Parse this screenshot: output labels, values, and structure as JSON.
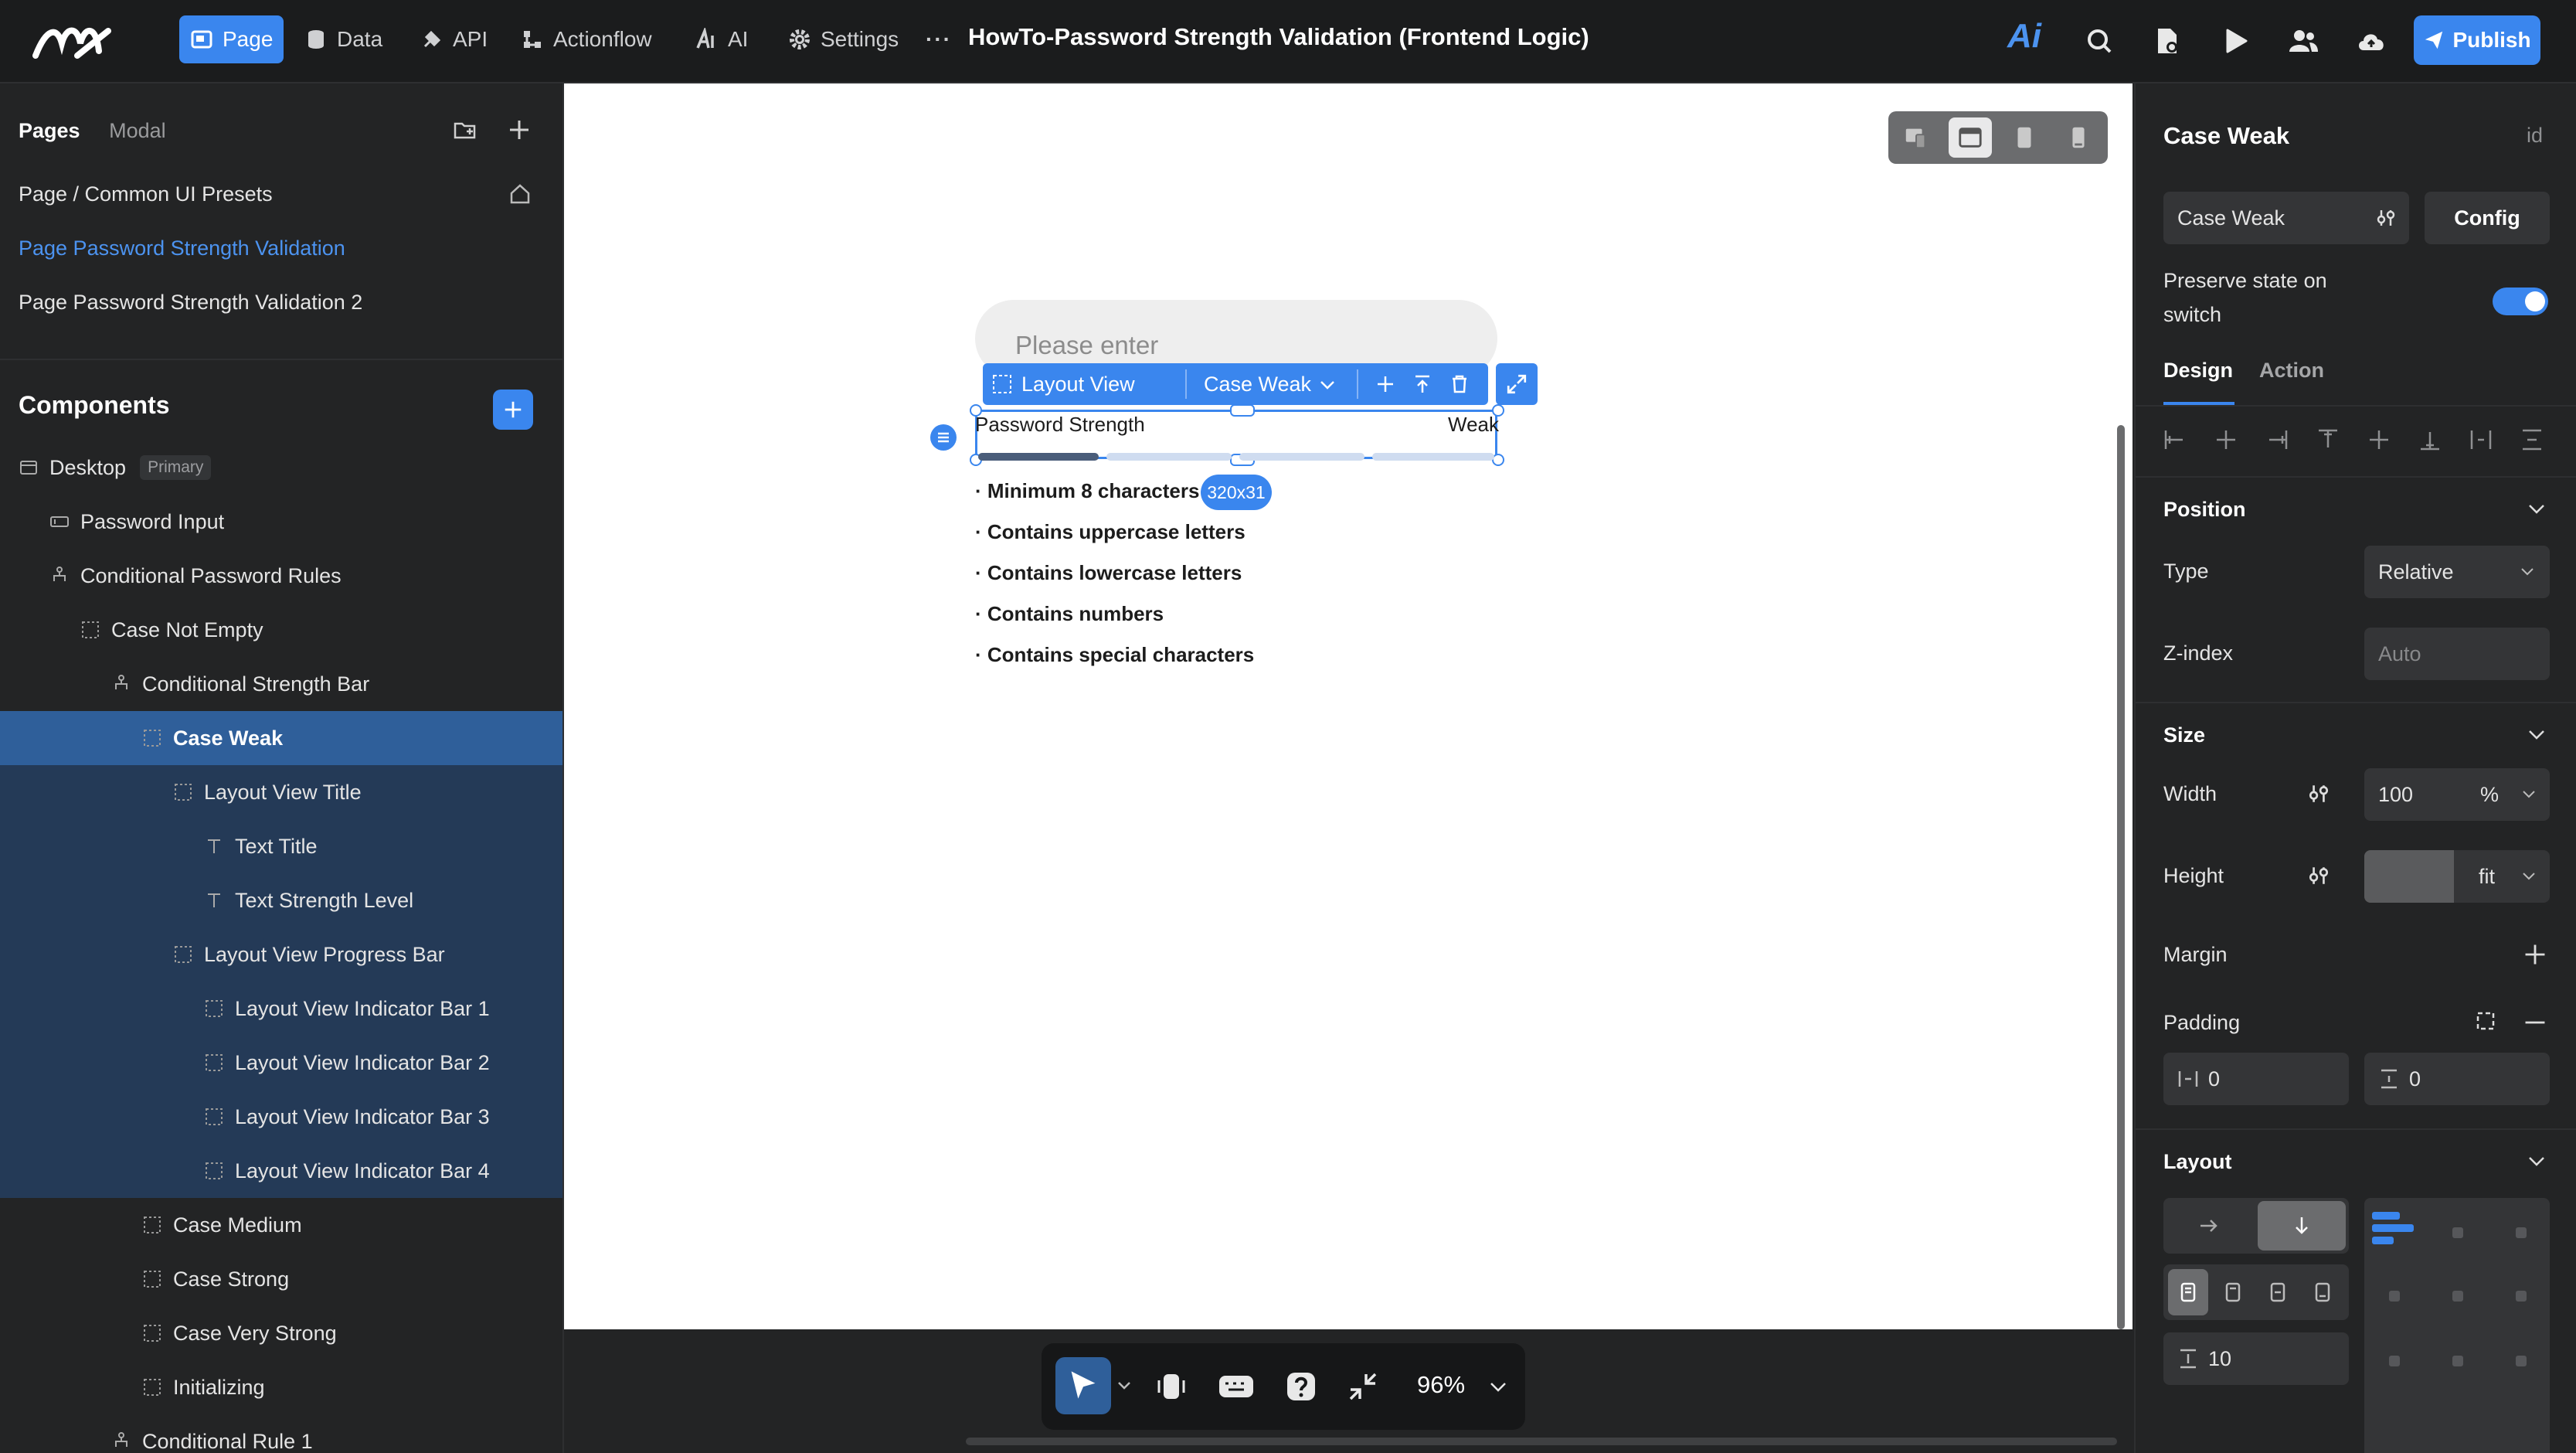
{
  "topbar": {
    "nav": [
      "Page",
      "Data",
      "API",
      "Actionflow",
      "AI",
      "Settings"
    ],
    "more": "···",
    "title": "HowTo-Password Strength Validation (Frontend Logic)",
    "ai_label": "Ai",
    "publish": "Publish"
  },
  "left": {
    "tabs": [
      "Pages",
      "Modal"
    ],
    "pages": [
      "Page / Common UI Presets",
      "Page Password Strength Validation",
      "Page Password Strength Validation 2"
    ],
    "components_title": "Components",
    "tree": [
      {
        "label": "Desktop",
        "badge": "Primary"
      },
      {
        "label": "Password Input"
      },
      {
        "label": "Conditional Password Rules"
      },
      {
        "label": "Case Not Empty"
      },
      {
        "label": "Conditional Strength Bar"
      },
      {
        "label": "Case Weak"
      },
      {
        "label": "Layout View Title"
      },
      {
        "label": "Text Title"
      },
      {
        "label": "Text Strength Level"
      },
      {
        "label": "Layout View Progress Bar"
      },
      {
        "label": "Layout View Indicator Bar 1"
      },
      {
        "label": "Layout View Indicator Bar 2"
      },
      {
        "label": "Layout View Indicator Bar 3"
      },
      {
        "label": "Layout View Indicator Bar 4"
      },
      {
        "label": "Case Medium"
      },
      {
        "label": "Case Strong"
      },
      {
        "label": "Case Very Strong"
      },
      {
        "label": "Initializing"
      },
      {
        "label": "Conditional Rule 1"
      }
    ]
  },
  "canvas": {
    "input_placeholder": "Please enter",
    "toolbar_layout": "Layout View",
    "toolbar_case": "Case Weak",
    "strength_title": "Password Strength",
    "strength_level": "Weak",
    "size_badge": "320x31",
    "rules": [
      "· Minimum 8 characters",
      "· Contains uppercase letters",
      "· Contains lowercase letters",
      "· Contains numbers",
      "· Contains special characters"
    ],
    "zoom": "96%",
    "colors": {
      "accent": "#3a86ee",
      "bar_active": "#4a5d7a",
      "bar_inactive": "#cfdcf0"
    }
  },
  "right": {
    "title": "Case Weak",
    "id_label": "id",
    "case_select": "Case Weak",
    "config": "Config",
    "preserve": [
      "Preserve state on",
      "switch"
    ],
    "preserve_on": true,
    "tabs": [
      "Design",
      "Action"
    ],
    "position": "Position",
    "type_label": "Type",
    "type_value": "Relative",
    "zindex_label": "Z-index",
    "zindex_placeholder": "Auto",
    "size": "Size",
    "width_label": "Width",
    "width_value": "100",
    "width_unit": "%",
    "height_label": "Height",
    "height_unit": "fit",
    "margin_label": "Margin",
    "padding_label": "Padding",
    "padding_h": "0",
    "padding_v": "0",
    "layout": "Layout",
    "gap_value": "10"
  }
}
